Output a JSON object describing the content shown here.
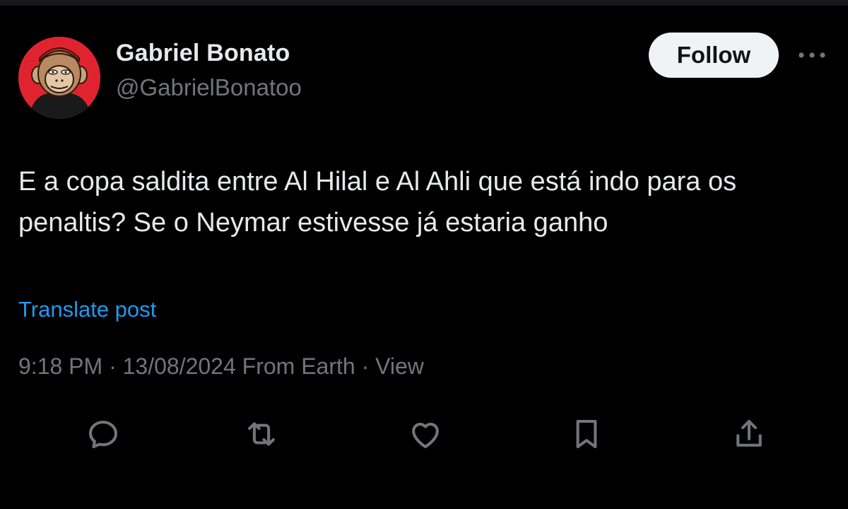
{
  "author": {
    "display_name": "Gabriel Bonato",
    "handle": "@GabrielBonatoo"
  },
  "follow_button": {
    "label": "Follow"
  },
  "post": {
    "text": "E a copa saldita entre Al Hilal e Al Ahli que está indo para os penaltis? Se o Neymar estivesse já estaria ganho",
    "translate_label": "Translate post"
  },
  "meta": {
    "time": "9:18 PM",
    "sep1": " · ",
    "date": "13/08/2024",
    "source": "From Earth",
    "sep2": " · ",
    "views_label": "View"
  },
  "actions": {
    "reply_icon": "reply-icon",
    "repost_icon": "repost-icon",
    "like_icon": "like-icon",
    "bookmark_icon": "bookmark-icon",
    "share_icon": "share-icon"
  },
  "colors": {
    "background": "#000000",
    "primary_text": "#e7e9ea",
    "secondary_text": "#71767b",
    "link": "#1d9bf0",
    "follow_bg": "#eff3f4",
    "avatar_bg": "#e0242f"
  }
}
